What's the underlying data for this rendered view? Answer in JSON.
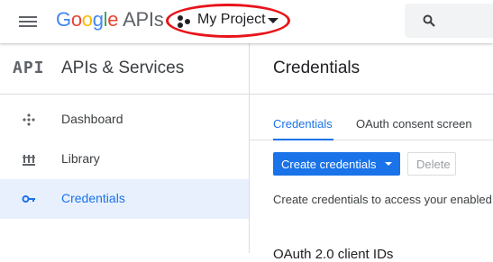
{
  "brand": {
    "google_letters": [
      "G",
      "o",
      "o",
      "g",
      "l",
      "e"
    ],
    "product": "APIs"
  },
  "project": {
    "name": "My Project"
  },
  "sidebar": {
    "logo_text": "API",
    "title": "APIs & Services",
    "items": [
      {
        "label": "Dashboard",
        "icon": "dashboard-icon",
        "active": false
      },
      {
        "label": "Library",
        "icon": "library-icon",
        "active": false
      },
      {
        "label": "Credentials",
        "icon": "key-icon",
        "active": true
      }
    ]
  },
  "main": {
    "title": "Credentials",
    "tabs": [
      {
        "label": "Credentials",
        "active": true
      },
      {
        "label": "OAuth consent screen",
        "active": false
      }
    ],
    "toolbar": {
      "create_label": "Create credentials",
      "delete_label": "Delete"
    },
    "help_text": "Create credentials to access your enabled",
    "section_heading": "OAuth 2.0 client IDs"
  },
  "colors": {
    "accent": "#1a73e8",
    "highlight_circle": "#e8141b",
    "active_nav_bg": "#e8f0fe"
  }
}
